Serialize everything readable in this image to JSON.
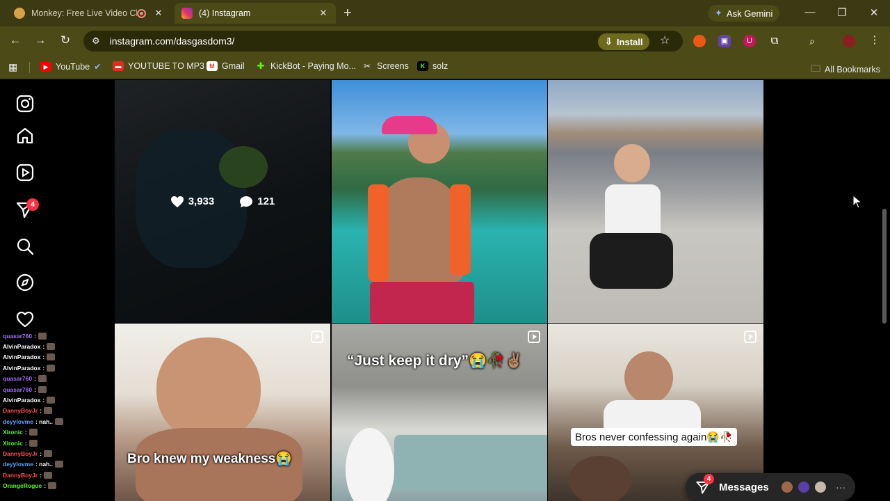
{
  "tabs": [
    {
      "title": "Monkey: Free Live Video Ch",
      "favicon_color": "#d7a14b",
      "recording": true,
      "active": false
    },
    {
      "title": "(4) Instagram",
      "favicon_color": "#e1306c",
      "recording": false,
      "active": true
    }
  ],
  "gemini_label": "Ask Gemini",
  "url": "instagram.com/dasgasdom3/",
  "install_label": "Install",
  "bookmarks": [
    {
      "label": "YouTube",
      "icon": "youtube-icon",
      "color": "#ff0000"
    },
    {
      "label": "YOUTUBE TO MP3",
      "icon": "mp3-icon",
      "color": "#d93025"
    },
    {
      "label": "Gmail",
      "icon": "gmail-icon",
      "color": "#ea4335"
    },
    {
      "label": "KickBot - Paying Mo...",
      "icon": "kickbot-icon",
      "color": "#53fc18"
    },
    {
      "label": "Screens",
      "icon": "screens-icon",
      "color": "#e8eaed"
    },
    {
      "label": "solz",
      "icon": "solz-icon",
      "color": "#53fc18"
    }
  ],
  "all_bookmarks_label": "All Bookmarks",
  "sidebar": {
    "notifications_badge": "4",
    "items": [
      "instagram-logo",
      "home",
      "reels",
      "messages",
      "search",
      "explore",
      "notifications"
    ]
  },
  "posts": [
    {
      "type": "photo",
      "likes": "3,933",
      "comments": "121",
      "hovered": true
    },
    {
      "type": "photo",
      "hovered": false
    },
    {
      "type": "photo",
      "hovered": false
    },
    {
      "type": "reel",
      "caption": "Bro knew my weakness😭"
    },
    {
      "type": "reel",
      "caption": "“Just keep it dry”😭🥀✌🏽"
    },
    {
      "type": "reel",
      "caption": "Bros never confessing again😭🥀"
    }
  ],
  "chat_overlay": [
    {
      "user": "quasar760",
      "color": "#a970ff",
      "msg": ":"
    },
    {
      "user": "AlvinParadox",
      "color": "#ffffff",
      "msg": ":"
    },
    {
      "user": "AlvinParadox",
      "color": "#ffffff",
      "msg": ":"
    },
    {
      "user": "AlvinParadox",
      "color": "#ffffff",
      "msg": ":"
    },
    {
      "user": "quasar760",
      "color": "#a970ff",
      "msg": ":"
    },
    {
      "user": "quasar760",
      "color": "#a970ff",
      "msg": ":"
    },
    {
      "user": "AlvinParadox",
      "color": "#ffffff",
      "msg": ":"
    },
    {
      "user": "DannyBoyJr",
      "color": "#ff4d4d",
      "msg": ":"
    },
    {
      "user": "deyylovme",
      "color": "#5fa8ff",
      "msg": ": nah.."
    },
    {
      "user": "Xironic",
      "color": "#53fc18",
      "msg": ":"
    },
    {
      "user": "Xironic",
      "color": "#53fc18",
      "msg": ":"
    },
    {
      "user": "DannyBoyJr",
      "color": "#ff4d4d",
      "msg": ":"
    },
    {
      "user": "deyylovme",
      "color": "#5fa8ff",
      "msg": ": nah.."
    },
    {
      "user": "DannyBoyJr",
      "color": "#ff4d4d",
      "msg": ":"
    },
    {
      "user": "OrangeRogue",
      "color": "#53fc18",
      "msg": ":"
    }
  ],
  "messages_button": {
    "label": "Messages",
    "badge": "4"
  }
}
